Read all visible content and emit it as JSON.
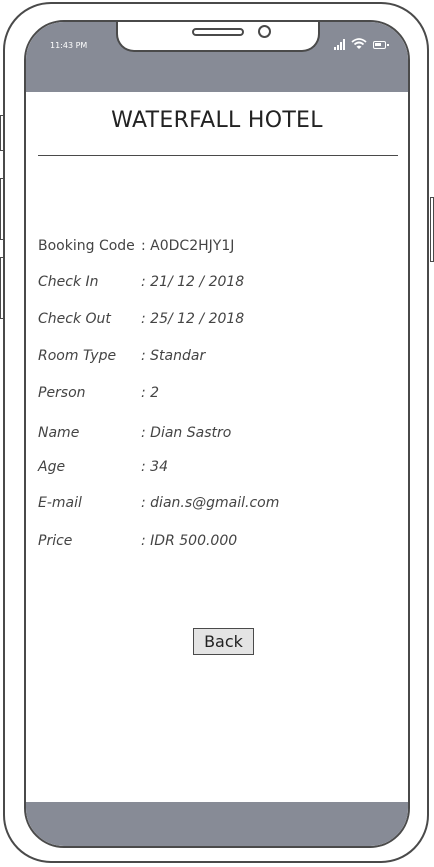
{
  "status_bar": {
    "time": "11:43 PM"
  },
  "header": {
    "title": "WATERFALL HOTEL"
  },
  "booking": {
    "rows": [
      {
        "label": "Booking Code",
        "value": "A0DC2HJY1J"
      },
      {
        "label": "Check In",
        "value": "21/ 12 / 2018"
      },
      {
        "label": "Check Out",
        "value": "25/ 12 / 2018"
      },
      {
        "label": "Room Type",
        "value": "Standar"
      },
      {
        "label": "Person",
        "value": "2"
      },
      {
        "label": "Name",
        "value": "Dian Sastro"
      },
      {
        "label": "Age",
        "value": "34"
      },
      {
        "label": "E-mail",
        "value": "dian.s@gmail.com"
      },
      {
        "label": "Price",
        "value": "IDR 500.000"
      }
    ]
  },
  "actions": {
    "back_label": "Back"
  },
  "icons": {
    "signal": "signal-icon",
    "wifi": "wifi-icon",
    "battery": "battery-icon"
  },
  "colors": {
    "bar": "#878b96",
    "outline": "#4a4a4a",
    "button_bg": "#e4e4e4"
  }
}
